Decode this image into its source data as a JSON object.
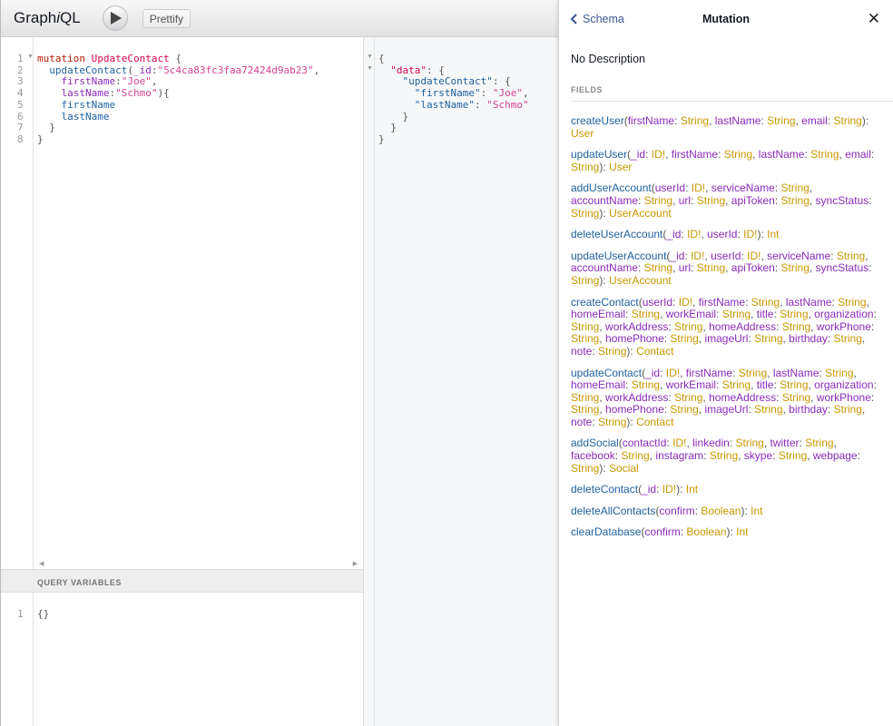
{
  "app": {
    "title_pre": "Graph",
    "title_i": "i",
    "title_post": "QL",
    "prettify_label": "Prettify"
  },
  "query": {
    "lines": [
      [
        [
          "kw",
          "mutation "
        ],
        [
          "def",
          "UpdateContact"
        ],
        [
          "pun",
          " {"
        ]
      ],
      [
        [
          "pun",
          "  "
        ],
        [
          "prop",
          "updateContact"
        ],
        [
          "pun",
          "("
        ],
        [
          "attr",
          "_id"
        ],
        [
          "pun",
          ":"
        ],
        [
          "str",
          "\"5c4ca83fc3faa72424d9ab23\""
        ],
        [
          "pun",
          ","
        ]
      ],
      [
        [
          "pun",
          "    "
        ],
        [
          "attr",
          "firstName"
        ],
        [
          "pun",
          ":"
        ],
        [
          "str",
          "\"Joe\""
        ],
        [
          "pun",
          ","
        ]
      ],
      [
        [
          "pun",
          "    "
        ],
        [
          "attr",
          "lastName"
        ],
        [
          "pun",
          ":"
        ],
        [
          "str",
          "\"Schmo\""
        ],
        [
          "pun",
          "){"
        ]
      ],
      [
        [
          "pun",
          "    "
        ],
        [
          "prop",
          "firstName"
        ]
      ],
      [
        [
          "pun",
          "    "
        ],
        [
          "prop",
          "lastName"
        ]
      ],
      [
        [
          "pun",
          "  }"
        ]
      ],
      [
        [
          "pun",
          "}"
        ]
      ]
    ]
  },
  "variables": {
    "header": "QUERY VARIABLES",
    "lines": [
      [
        [
          "pun",
          "{}"
        ]
      ]
    ]
  },
  "result": {
    "lines": [
      [
        [
          "pun",
          "{"
        ]
      ],
      [
        [
          "pun",
          "  "
        ],
        [
          "def",
          "\"data\""
        ],
        [
          "pun",
          ": {"
        ]
      ],
      [
        [
          "pun",
          "    "
        ],
        [
          "prop",
          "\"updateContact\""
        ],
        [
          "pun",
          ": {"
        ]
      ],
      [
        [
          "pun",
          "      "
        ],
        [
          "prop",
          "\"firstName\""
        ],
        [
          "pun",
          ": "
        ],
        [
          "str",
          "\"Joe\""
        ],
        [
          "pun",
          ","
        ]
      ],
      [
        [
          "pun",
          "      "
        ],
        [
          "prop",
          "\"lastName\""
        ],
        [
          "pun",
          ": "
        ],
        [
          "str",
          "\"Schmo\""
        ]
      ],
      [
        [
          "pun",
          "    }"
        ]
      ],
      [
        [
          "pun",
          "  }"
        ]
      ],
      [
        [
          "pun",
          "}"
        ]
      ]
    ]
  },
  "docs": {
    "back_label": "Schema",
    "title": "Mutation",
    "description": "No Description",
    "fields_header": "FIELDS",
    "fields": [
      {
        "name": "createUser",
        "args": [
          [
            "firstName",
            "String"
          ],
          [
            "lastName",
            "String"
          ],
          [
            "email",
            "String"
          ]
        ],
        "type": "User"
      },
      {
        "name": "updateUser",
        "args": [
          [
            "_id",
            "ID!"
          ],
          [
            "firstName",
            "String"
          ],
          [
            "lastName",
            "String"
          ],
          [
            "email",
            "String"
          ]
        ],
        "type": "User"
      },
      {
        "name": "addUserAccount",
        "args": [
          [
            "userId",
            "ID!"
          ],
          [
            "serviceName",
            "String"
          ],
          [
            "accountName",
            "String"
          ],
          [
            "url",
            "String"
          ],
          [
            "apiToken",
            "String"
          ],
          [
            "syncStatus",
            "String"
          ]
        ],
        "type": "UserAccount"
      },
      {
        "name": "deleteUserAccount",
        "args": [
          [
            "_id",
            "ID!"
          ],
          [
            "userId",
            "ID!"
          ]
        ],
        "type": "Int"
      },
      {
        "name": "updateUserAccount",
        "args": [
          [
            "_id",
            "ID!"
          ],
          [
            "userId",
            "ID!"
          ],
          [
            "serviceName",
            "String"
          ],
          [
            "accountName",
            "String"
          ],
          [
            "url",
            "String"
          ],
          [
            "apiToken",
            "String"
          ],
          [
            "syncStatus",
            "String"
          ]
        ],
        "type": "UserAccount"
      },
      {
        "name": "createContact",
        "args": [
          [
            "userId",
            "ID!"
          ],
          [
            "firstName",
            "String"
          ],
          [
            "lastName",
            "String"
          ],
          [
            "homeEmail",
            "String"
          ],
          [
            "workEmail",
            "String"
          ],
          [
            "title",
            "String"
          ],
          [
            "organization",
            "String"
          ],
          [
            "workAddress",
            "String"
          ],
          [
            "homeAddress",
            "String"
          ],
          [
            "workPhone",
            "String"
          ],
          [
            "homePhone",
            "String"
          ],
          [
            "imageUrl",
            "String"
          ],
          [
            "birthday",
            "String"
          ],
          [
            "note",
            "String"
          ]
        ],
        "type": "Contact"
      },
      {
        "name": "updateContact",
        "args": [
          [
            "_id",
            "ID!"
          ],
          [
            "firstName",
            "String"
          ],
          [
            "lastName",
            "String"
          ],
          [
            "homeEmail",
            "String"
          ],
          [
            "workEmail",
            "String"
          ],
          [
            "title",
            "String"
          ],
          [
            "organization",
            "String"
          ],
          [
            "workAddress",
            "String"
          ],
          [
            "homeAddress",
            "String"
          ],
          [
            "workPhone",
            "String"
          ],
          [
            "homePhone",
            "String"
          ],
          [
            "imageUrl",
            "String"
          ],
          [
            "birthday",
            "String"
          ],
          [
            "note",
            "String"
          ]
        ],
        "type": "Contact"
      },
      {
        "name": "addSocial",
        "args": [
          [
            "contactId",
            "ID!"
          ],
          [
            "linkedin",
            "String"
          ],
          [
            "twitter",
            "String"
          ],
          [
            "facebook",
            "String"
          ],
          [
            "instagram",
            "String"
          ],
          [
            "skype",
            "String"
          ],
          [
            "webpage",
            "String"
          ]
        ],
        "type": "Social"
      },
      {
        "name": "deleteContact",
        "args": [
          [
            "_id",
            "ID!"
          ]
        ],
        "type": "Int"
      },
      {
        "name": "deleteAllContacts",
        "args": [
          [
            "confirm",
            "Boolean"
          ]
        ],
        "type": "Int"
      },
      {
        "name": "clearDatabase",
        "args": [
          [
            "confirm",
            "Boolean"
          ]
        ],
        "type": "Int"
      }
    ]
  }
}
